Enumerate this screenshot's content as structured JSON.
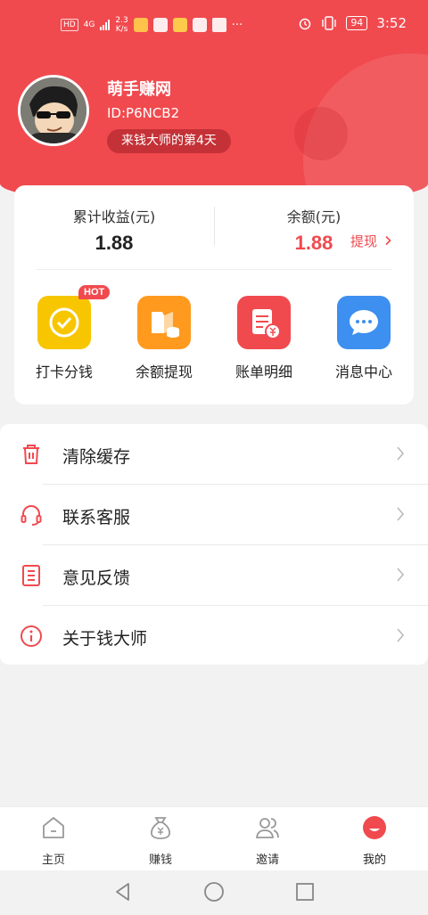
{
  "status_bar": {
    "network_badge": "HD",
    "network_type": "4G",
    "speed": "2.3",
    "speed_unit": "K/s",
    "battery": "94",
    "time": "3:52",
    "more": "···"
  },
  "profile": {
    "name": "萌手赚网",
    "id": "ID:P6NCB2",
    "days_badge": "来钱大师的第4天"
  },
  "stats": {
    "total_label": "累计收益(元)",
    "total_value": "1.88",
    "balance_label": "余额(元)",
    "balance_value": "1.88",
    "withdraw_label": "提现"
  },
  "tiles": [
    {
      "label": "打卡分钱",
      "icon": "check-circle-icon",
      "color": "#f7c600"
    },
    {
      "label": "余额提现",
      "icon": "wallet-coins-icon",
      "color": "#ff9a1f"
    },
    {
      "label": "账单明细",
      "icon": "bill-yuan-icon",
      "color": "#f04a4f"
    },
    {
      "label": "消息中心",
      "icon": "chat-bubble-icon",
      "color": "#3d8ff0"
    }
  ],
  "hot_badge": "HOT",
  "menu": [
    {
      "label": "清除缓存",
      "icon": "trash-icon"
    },
    {
      "label": "联系客服",
      "icon": "headset-icon"
    },
    {
      "label": "意见反馈",
      "icon": "document-icon"
    },
    {
      "label": "关于钱大师",
      "icon": "info-icon"
    }
  ],
  "tabs": [
    {
      "label": "主页",
      "icon": "home-icon"
    },
    {
      "label": "赚钱",
      "icon": "money-bag-icon"
    },
    {
      "label": "邀请",
      "icon": "users-icon"
    },
    {
      "label": "我的",
      "icon": "profile-icon",
      "active": true
    }
  ],
  "colors": {
    "brand_red": "#f04a4f",
    "yellow": "#f7c600",
    "orange": "#ff9a1f",
    "blue": "#3d8ff0"
  }
}
